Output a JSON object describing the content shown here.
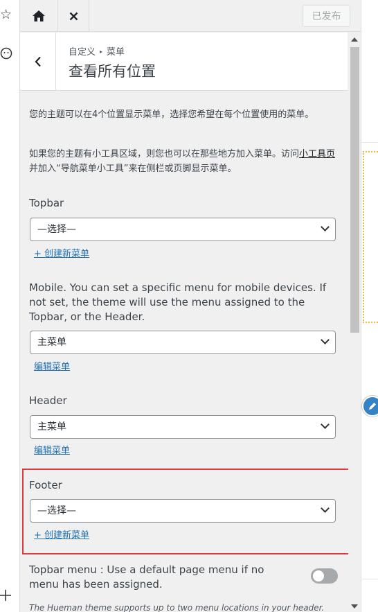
{
  "topbar": {
    "publish_label": "已发布"
  },
  "section": {
    "breadcrumb_parent": "自定义",
    "breadcrumb_current": "菜单",
    "title": "查看所有位置"
  },
  "description": {
    "para1": "您的主题可以在4个位置显示菜单，选择您希望在每个位置使用的菜单。",
    "para2_before": "如果您的主题有小工具区域，则您也可以在那些地方加入菜单。访问",
    "para2_link": "小工具页",
    "para2_after": "并加入“导航菜单小工具”来在侧栏或页脚显示菜单。"
  },
  "locations": [
    {
      "label": "Topbar",
      "selected": "—选择—",
      "action": "+ 创建新菜单"
    },
    {
      "label": "Mobile. You can set a specific menu for mobile devices. If not set, the theme will use the menu assigned to the Topbar, or the Header.",
      "selected": "主菜单",
      "action": "编辑菜单"
    },
    {
      "label": "Header",
      "selected": "主菜单",
      "action": "编辑菜单"
    },
    {
      "label": "Footer",
      "selected": "—选择—",
      "action": "+ 创建新菜单"
    }
  ],
  "topbar_default": {
    "label": "Topbar menu : Use a default page menu if no menu has been assigned.",
    "enabled": false
  },
  "footnote": "The Hueman theme supports up to two menu locations in your header.",
  "icons": {
    "home": "home-icon",
    "close": "close-icon",
    "back": "chevron-left-icon",
    "star": "star-icon",
    "smiley": "smiley-icon",
    "plus": "plus-icon",
    "edit": "pencil-icon"
  },
  "colors": {
    "highlight": "#e0393e",
    "link": "#2271b1",
    "edit_button": "#3582c4",
    "dotted_outline": "#f0b849"
  }
}
